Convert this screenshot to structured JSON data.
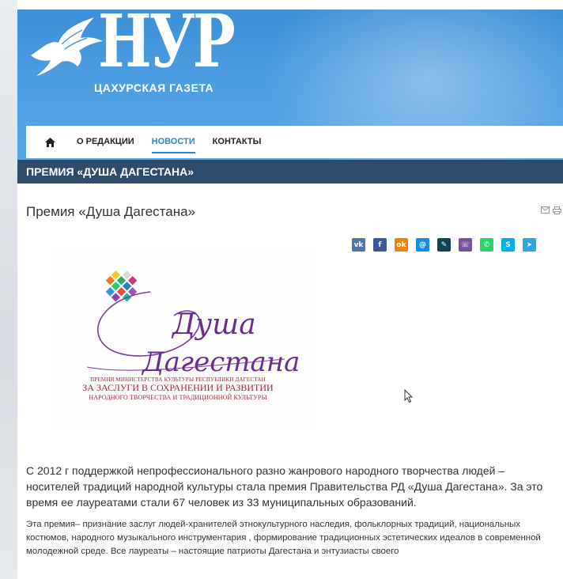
{
  "header": {
    "logo_text": "НУР",
    "logo_subtitle": "ЦАХУРСКАЯ ГАЗЕТА",
    "colors": {
      "header_blue": "#4a9be0",
      "active_blue": "#2a86d3",
      "title_bar": "#2d4b6b"
    }
  },
  "nav": {
    "home_icon": "home-icon",
    "items": [
      {
        "label": "О РЕДАКЦИИ",
        "active": false
      },
      {
        "label": "НОВОСТИ",
        "active": true
      },
      {
        "label": "КОНТАКТЫ",
        "active": false
      }
    ]
  },
  "category_title": "ПРЕМИЯ «ДУША ДАГЕСТАНА»",
  "article": {
    "title": "Премия «Душа Дагестана»",
    "tools": [
      "email-icon",
      "print-icon"
    ],
    "share": [
      {
        "name": "vk-share-icon",
        "glyph": "vk",
        "color": "#4a76a8"
      },
      {
        "name": "facebook-share-icon",
        "glyph": "f",
        "color": "#3b5998"
      },
      {
        "name": "odnoklassniki-share-icon",
        "glyph": "ok",
        "color": "#ee8208"
      },
      {
        "name": "moimir-share-icon",
        "glyph": "@",
        "color": "#168de2"
      },
      {
        "name": "livejournal-share-icon",
        "glyph": "✎",
        "color": "#0d425a"
      },
      {
        "name": "viber-share-icon",
        "glyph": "☏",
        "color": "#7b519d"
      },
      {
        "name": "whatsapp-share-icon",
        "glyph": "✆",
        "color": "#25d366"
      },
      {
        "name": "skype-share-icon",
        "glyph": "S",
        "color": "#00aff0"
      },
      {
        "name": "telegram-share-icon",
        "glyph": "➤",
        "color": "#2ca5e0"
      }
    ],
    "image": {
      "script_line1": "Душа",
      "script_line2": "Дагестана",
      "caption_line1": "ПРЕМИЯ МИНИСТЕРСТВА КУЛЬТУРЫ РЕСПУБЛИКИ ДАГЕСТАН",
      "caption_line2": "ЗА ЗАСЛУГИ В СОХРАНЕНИИ И РАЗВИТИИ",
      "caption_line3": "НАРОДНОГО ТВОРЧЕСТВА И ТРАДИЦИОННОЙ КУЛЬТУРЫ"
    },
    "paragraph1": "С 2012 г поддержкой непрофессионального разно жанрового народного творчества людей – носителей традиций народной культуры стала премия Правительства РД «Душа  Дагестана». За это время ее лауреатами  стали 67 человек из 33 муниципальных образований.",
    "paragraph2": "Эта премия– признание заслуг людей-хранителей этнокультурного наследия, фольклорных традиций, национальных костюмов, народного музыкального инструментария , формирование традиционных эстетических идеалов в современной молодежной среде. Все лауреаты – настоящие патриоты Дагестана  и энтузиасты своего"
  }
}
